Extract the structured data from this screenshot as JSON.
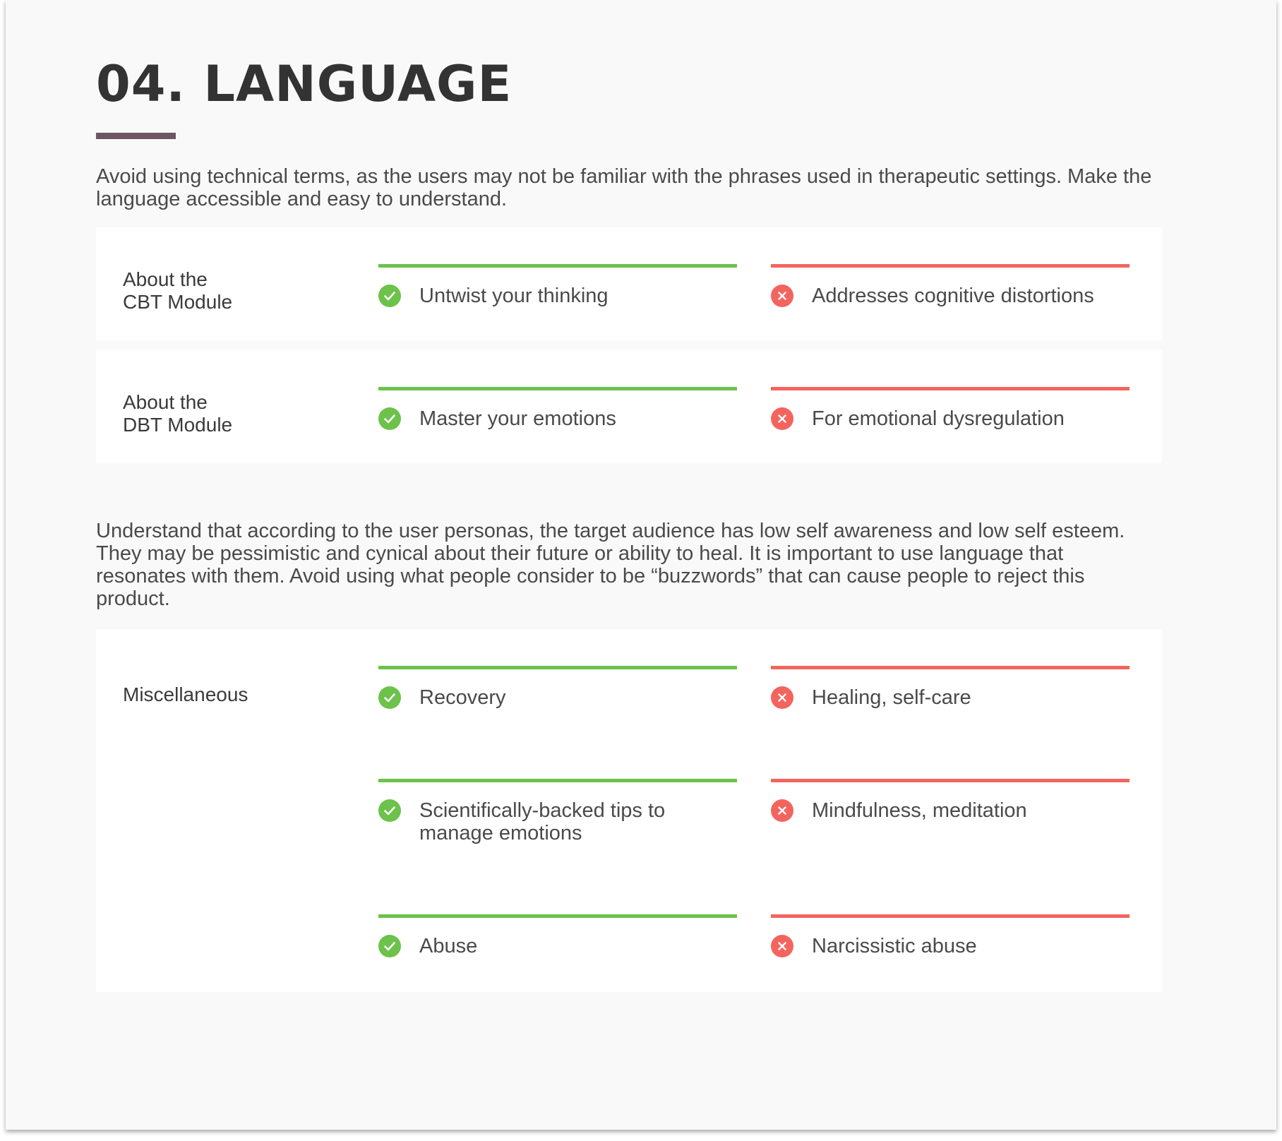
{
  "colors": {
    "accent": "#6e5560",
    "good": "#6cc24a",
    "bad": "#f4645f"
  },
  "title": "04. LANGUAGE",
  "intro": "Avoid using technical terms, as the users may not be familiar with the phrases used in therapeutic settings. Make the language accessible and easy to understand.",
  "second_paragraph": "Understand that according to the user personas, the target audience has low self awareness and low self esteem. They may be pessimistic and cynical about their future or ability to heal. It is important to use language that resonates with them. Avoid using what people consider to be “buzzwords” that can cause people to reject this product.",
  "cards": [
    {
      "label_lines": [
        "About the",
        "CBT Module"
      ],
      "examples": [
        {
          "do": "Untwist your thinking",
          "dont": "Addresses cognitive distortions"
        }
      ]
    },
    {
      "label_lines": [
        "About the",
        "DBT Module"
      ],
      "examples": [
        {
          "do": "Master your emotions",
          "dont": "For emotional dysregulation"
        }
      ]
    },
    {
      "label_lines": [
        "Miscellaneous"
      ],
      "examples": [
        {
          "do": "Recovery",
          "dont": "Healing, self-care"
        },
        {
          "do": "Scientifically-backed tips to manage emotions",
          "dont": "Mindfulness, meditation"
        },
        {
          "do": "Abuse",
          "dont": "Narcissistic abuse"
        }
      ]
    }
  ],
  "icons": {
    "do": "check-circle-icon",
    "dont": "x-circle-icon"
  }
}
